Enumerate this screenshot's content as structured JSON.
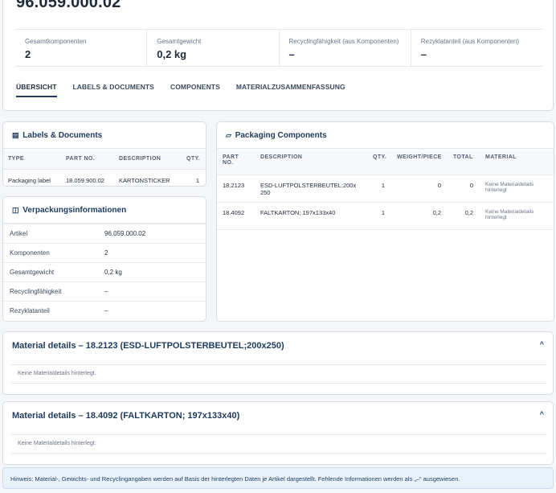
{
  "header": {
    "article_no": "96.059.000.02",
    "kpis": [
      {
        "label": "Gesamtkomponenten",
        "value": "2"
      },
      {
        "label": "Gesamtgewicht",
        "value": "0,2 kg"
      },
      {
        "label": "Recyclingfähigkeit (aus Komponenten)",
        "value": "–"
      },
      {
        "label": "Rezyklatanteil (aus Komponenten)",
        "value": "–"
      }
    ],
    "tabs": [
      "ÜBERSICHT",
      "LABELS & DOCUMENTS",
      "COMPONENTS",
      "MATERIALZUSAMMENFASSUNG"
    ]
  },
  "labels_docs": {
    "title": "Labels & Documents",
    "icon": "document-icon",
    "columns": [
      "TYPE",
      "PART NO.",
      "DESCRIPTION",
      "QTY."
    ],
    "rows": [
      {
        "type": "Packaging label",
        "part_no": "18.059.900.02",
        "description": "KARTONSTICKER",
        "qty": "1"
      }
    ]
  },
  "verpackung": {
    "title": "Verpackungsinformationen",
    "icon": "columns-icon",
    "rows": [
      {
        "key": "Artikel",
        "value": "96.059.000.02"
      },
      {
        "key": "Komponenten",
        "value": "2"
      },
      {
        "key": "Gesamtgewicht",
        "value": "0,2 kg"
      },
      {
        "key": "Recyclingfähigkeit",
        "value": "–"
      },
      {
        "key": "Rezyklatanteil",
        "value": "–"
      }
    ]
  },
  "packaging": {
    "title": "Packaging Components",
    "icon": "box-outline-icon",
    "columns": [
      "PART",
      "NO.",
      "DESCRIPTION",
      "QTY.",
      "WEIGHT/PIECE",
      "TOTAL",
      "MATERIAL"
    ],
    "rows": [
      {
        "part_no": "18.2123",
        "description": "ESD-LUFTPOLSTERBEUTEL;200x250",
        "qty": "1",
        "weight": "0",
        "total": "0",
        "material": "Keine Materialdetails hinterlegt"
      },
      {
        "part_no": "18.4092",
        "description": "FALTKARTON; 197x133x40",
        "qty": "1",
        "weight": "0,2",
        "total": "0,2",
        "material": "Keine Materialdetails hinterlegt"
      }
    ]
  },
  "material_details": [
    {
      "title": "Material details – 18.2123 (ESD-LUFTPOLSTERBEUTEL;200x250)",
      "body": "Keine Materialdetails hinterlegt.",
      "caret": "^"
    },
    {
      "title": "Material details – 18.4092 (FALTKARTON; 197x133x40)",
      "body": "Keine Materialdetails hinterlegt.",
      "caret": "^"
    }
  ],
  "hint": "Hinweis: Material-, Gewichts- und Recyclingangaben werden auf Basis der hinterlegten Daten je Artikel dargestellt. Fehlende Informationen werden als „–“ ausgewiesen."
}
